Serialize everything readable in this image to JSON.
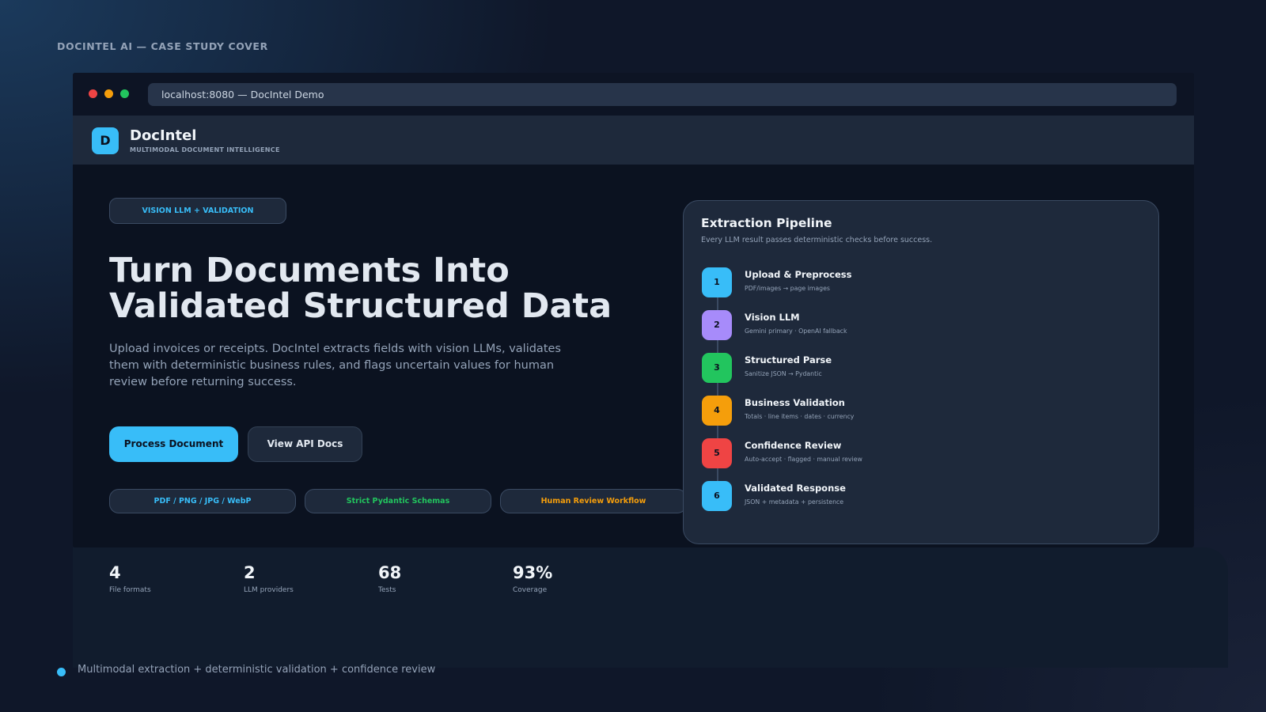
{
  "cover_label": "DOCINTEL AI — CASE STUDY COVER",
  "browser": {
    "url": "localhost:8080 — DocIntel Demo"
  },
  "header": {
    "logo_letter": "D",
    "brand_name": "DocIntel",
    "brand_tagline": "MULTIMODAL DOCUMENT INTELLIGENCE"
  },
  "hero": {
    "badge": "VISION LLM + VALIDATION",
    "title_line1": "Turn Documents Into",
    "title_line2": "Validated Structured Data",
    "subtitle": "Upload invoices or receipts. DocIntel extracts fields with vision LLMs, validates them with deterministic business rules, and flags uncertain values for human review before returning success.",
    "primary_button": "Process Document",
    "secondary_button": "View API Docs",
    "features": [
      {
        "label": "PDF / PNG / JPG / WebP",
        "color": "#38bdf8"
      },
      {
        "label": "Strict Pydantic Schemas",
        "color": "#22c55e"
      },
      {
        "label": "Human Review Workflow",
        "color": "#f59e0b"
      }
    ]
  },
  "pipeline": {
    "title": "Extraction Pipeline",
    "subtitle": "Every LLM result passes deterministic checks before success.",
    "steps": [
      {
        "number": "1",
        "title": "Upload & Preprocess",
        "desc": "PDF/images → page images",
        "color": "#38bdf8"
      },
      {
        "number": "2",
        "title": "Vision LLM",
        "desc": "Gemini primary · OpenAI fallback",
        "color": "#a78bfa"
      },
      {
        "number": "3",
        "title": "Structured Parse",
        "desc": "Sanitize JSON → Pydantic",
        "color": "#22c55e"
      },
      {
        "number": "4",
        "title": "Business Validation",
        "desc": "Totals · line items · dates · currency",
        "color": "#f59e0b"
      },
      {
        "number": "5",
        "title": "Confidence Review",
        "desc": "Auto-accept · flagged · manual review",
        "color": "#ef4444"
      },
      {
        "number": "6",
        "title": "Validated Response",
        "desc": "JSON + metadata + persistence",
        "color": "#38bdf8"
      }
    ]
  },
  "stats": [
    {
      "value": "4",
      "label": "File formats"
    },
    {
      "value": "2",
      "label": "LLM providers"
    },
    {
      "value": "68",
      "label": "Tests"
    },
    {
      "value": "93%",
      "label": "Coverage"
    }
  ],
  "footer": {
    "text": "Multimodal extraction + deterministic validation + confidence review"
  }
}
